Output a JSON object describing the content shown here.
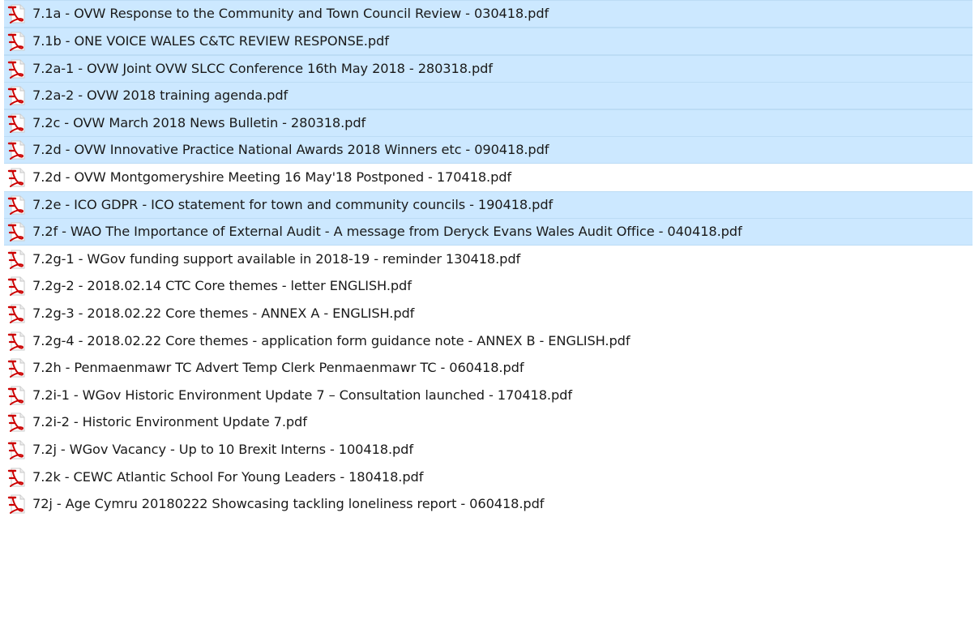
{
  "icon": "pdf-file-icon",
  "accent_color": "#cc0000",
  "selection_color": "#cce8ff",
  "files": [
    {
      "name": "7.1a - OVW Response to the Community and Town Council Review - 030418.pdf",
      "selected": true
    },
    {
      "name": "7.1b - ONE VOICE WALES C&TC REVIEW RESPONSE.pdf",
      "selected": true
    },
    {
      "name": "7.2a-1 - OVW Joint OVW SLCC Conference 16th May 2018 - 280318.pdf",
      "selected": true
    },
    {
      "name": "7.2a-2 - OVW 2018 training agenda.pdf",
      "selected": true
    },
    {
      "name": "7.2c - OVW March 2018 News Bulletin - 280318.pdf",
      "selected": true
    },
    {
      "name": "7.2d - OVW Innovative Practice National Awards 2018 Winners etc - 090418.pdf",
      "selected": true
    },
    {
      "name": "7.2d - OVW Montgomeryshire Meeting 16 May'18 Postponed - 170418.pdf",
      "selected": false
    },
    {
      "name": "7.2e - ICO GDPR - ICO statement for town and community councils - 190418.pdf",
      "selected": true
    },
    {
      "name": "7.2f - WAO The Importance of External Audit - A message from Deryck Evans Wales Audit Office - 040418.pdf",
      "selected": true
    },
    {
      "name": "7.2g-1 - WGov funding support available in 2018-19 - reminder 130418.pdf",
      "selected": false
    },
    {
      "name": "7.2g-2 - 2018.02.14 CTC Core themes - letter ENGLISH.pdf",
      "selected": false
    },
    {
      "name": "7.2g-3 - 2018.02.22 Core  themes - ANNEX A - ENGLISH.pdf",
      "selected": false
    },
    {
      "name": "7.2g-4 - 2018.02.22 Core  themes - application form guidance note - ANNEX B - ENGLISH.pdf",
      "selected": false
    },
    {
      "name": "7.2h - Penmaenmawr TC Advert Temp Clerk Penmaenmawr TC - 060418.pdf",
      "selected": false
    },
    {
      "name": "7.2i-1 - WGov  Historic Environment Update 7 – Consultation launched - 170418.pdf",
      "selected": false
    },
    {
      "name": "7.2i-2 - Historic Environment Update 7.pdf",
      "selected": false
    },
    {
      "name": "7.2j - WGov Vacancy - Up to 10 Brexit Interns - 100418.pdf",
      "selected": false
    },
    {
      "name": "7.2k - CEWC Atlantic School For Young Leaders - 180418.pdf",
      "selected": false
    },
    {
      "name": "72j - Age Cymru 20180222 Showcasing tackling loneliness report - 060418.pdf",
      "selected": false
    }
  ]
}
